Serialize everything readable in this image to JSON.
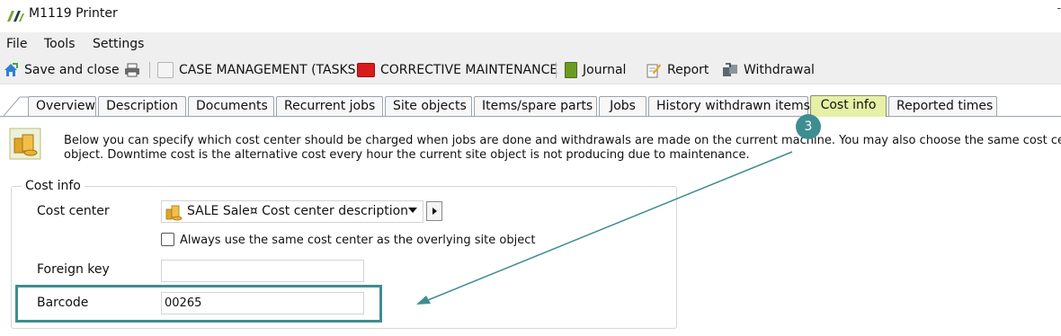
{
  "window": {
    "title": "M1119  Printer",
    "corner_glyph": "-"
  },
  "menu": {
    "items": [
      {
        "label": "File"
      },
      {
        "label": "Tools"
      },
      {
        "label": "Settings"
      }
    ]
  },
  "toolbar": {
    "save_close_label": "Save and close",
    "print_icon": "printer-icon",
    "case_management_label": "CASE MANAGEMENT (TASKS)",
    "corrective_maintenance_label": "CORRECTIVE MAINTENANCE",
    "journal_label": "Journal",
    "report_label": "Report",
    "withdrawal_label": "Withdrawal"
  },
  "tabs": [
    {
      "label": "Overview"
    },
    {
      "label": "Description"
    },
    {
      "label": "Documents"
    },
    {
      "label": "Recurrent jobs"
    },
    {
      "label": "Site objects"
    },
    {
      "label": "Items/spare parts"
    },
    {
      "label": "Jobs"
    },
    {
      "label": "History withdrawn items"
    },
    {
      "label": "Cost info",
      "active": true
    },
    {
      "label": "Reported times"
    }
  ],
  "annotation": {
    "step_number": "3",
    "accent_color": "#3e8d91"
  },
  "info": {
    "line1": "Below you can specify which cost center should be charged when jobs are done and withdrawals are made on the current machine. You may also choose the same cost center",
    "line2": "object. Downtime cost is the alternative cost every hour the current site object is not producing due to maintenance."
  },
  "cost_info": {
    "group_title": "Cost info",
    "cost_center_label": "Cost center",
    "cost_center_value": "SALE Sale¤ Cost center description",
    "same_cost_center_checkbox_label": "Always use the same cost center as the overlying site object",
    "same_cost_center_checked": false,
    "foreign_key_label": "Foreign key",
    "foreign_key_value": "",
    "barcode_label": "Barcode",
    "barcode_value": "00265"
  }
}
